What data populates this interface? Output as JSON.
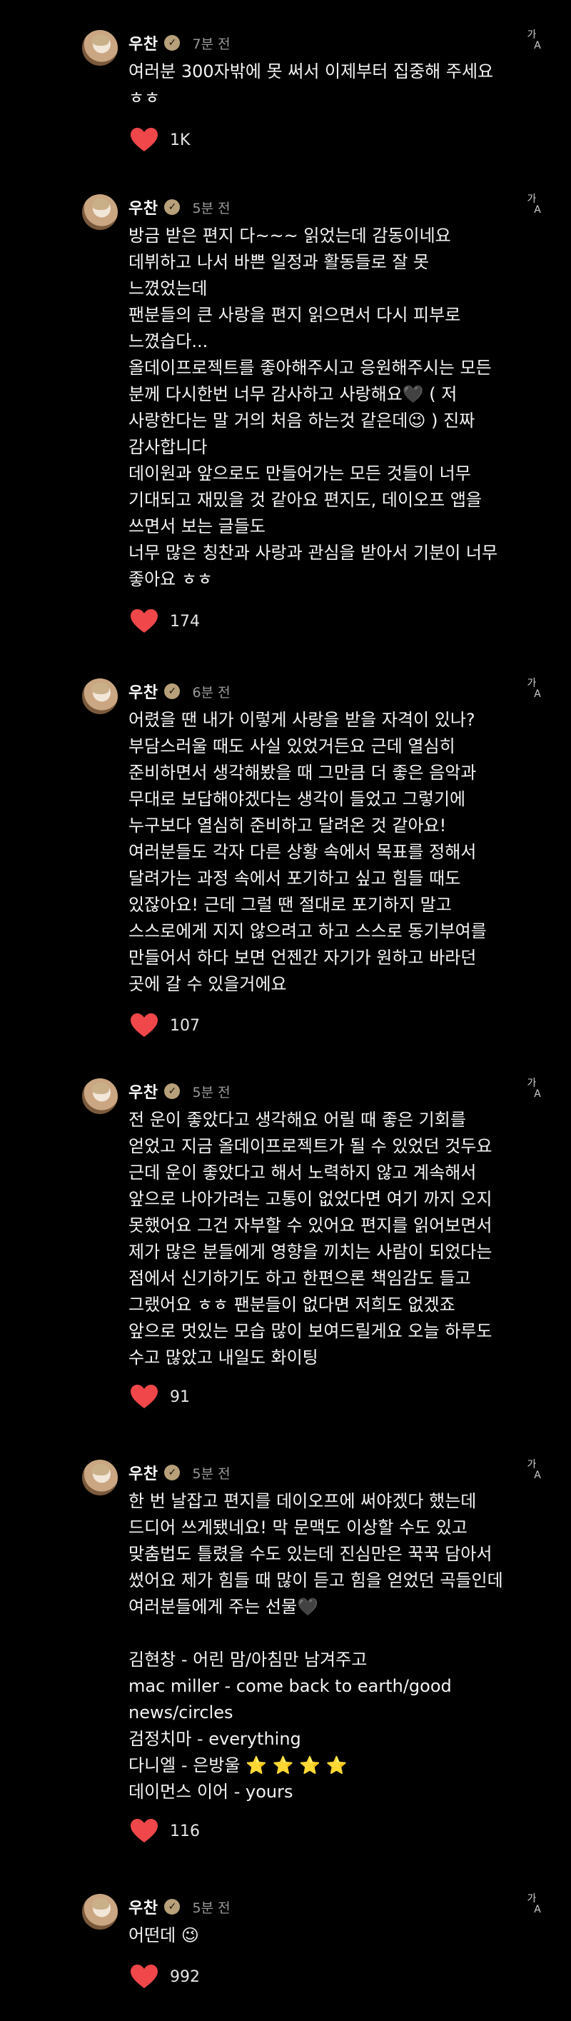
{
  "posts": [
    {
      "author": "우찬",
      "time": "7분 전",
      "text": "여러분 300자밖에 못 써서 이제부터 집중해 주세요 ㅎㅎ",
      "likes": "1K"
    },
    {
      "author": "우찬",
      "time": "5분 전",
      "text": "방금 받은 편지 다~~~ 읽었는데 감동이네요\n데뷔하고 나서 바쁜 일정과 활동들로 잘 못 느꼈었는데\n팬분들의 큰 사랑을 편지 읽으면서 다시 피부로 느꼈습다...\n올데이프로젝트를 좋아해주시고 응원해주시는 모든 분께 다시한번 너무 감사하고 사랑해요🖤 ( 저 사랑한다는 말 거의 처음 하는것 같은데😉 ) 진짜 감사합니다\n데이원과 앞으로도 만들어가는 모든 것들이 너무 기대되고 재밌을 것 같아요 편지도, 데이오프 앱을 쓰면서 보는 글들도\n너무 많은 칭찬과 사랑과 관심을 받아서 기분이 너무 좋아요 ㅎㅎ",
      "likes": "174"
    },
    {
      "author": "우찬",
      "time": "6분 전",
      "text": "어렸을 땐 내가 이렇게 사랑을 받을 자격이 있나? 부담스러울 때도 사실 있었거든요 근데 열심히 준비하면서 생각해봤을 때 그만큼 더 좋은 음악과 무대로 보답해야겠다는 생각이 들었고 그렇기에 누구보다 열심히 준비하고 달려온 것 같아요! 여러분들도 각자 다른 상황 속에서 목표를 정해서 달려가는 과정 속에서 포기하고 싶고 힘들 때도 있잖아요! 근데 그럴 땐 절대로 포기하지 말고 스스로에게 지지 않으려고 하고 스스로 동기부여를 만들어서 하다 보면 언젠간 자기가 원하고 바라던 곳에 갈 수 있을거에요",
      "likes": "107"
    },
    {
      "author": "우찬",
      "time": "5분 전",
      "text": "전 운이 좋았다고 생각해요 어릴 때 좋은 기회를 얻었고 지금 올데이프로젝트가 될 수 있었던 것두요 근데 운이 좋았다고 해서 노력하지 않고 계속해서 앞으로 나아가려는 고통이 없었다면 여기 까지 오지 못했어요 그건 자부할 수 있어요 편지를 읽어보면서 제가 많은 분들에게 영향을 끼치는 사람이 되었다는 점에서 신기하기도 하고 한편으론 책임감도 들고 그랬어요 ㅎㅎ 팬분들이 없다면 저희도 없겠죠 앞으로 멋있는 모습 많이 보여드릴게요 오늘 하루도 수고 많았고 내일도 화이팅",
      "likes": "91"
    },
    {
      "author": "우찬",
      "time": "5분 전",
      "text": "한 번 날잡고 편지를 데이오프에 써야겠다 했는데 드디어 쓰게됐네요! 막 문맥도 이상할 수도 있고 맞춤법도 틀렸을 수도 있는데 진심만은 꾹꾹 담아서 썼어요 제가 힘들 때 많이 듣고 힘을 얻었던 곡들인데 여러분들에게 주는 선물🖤\n\n김현창 - 어린 맘/아침만 남겨주고\nmac miller - come back to earth/good news/circles\n검정치마 - everything\n다니엘 - 은방울 ⭐ ⭐ ⭐ ⭐\n데이먼스 이어 - yours",
      "likes": "116"
    },
    {
      "author": "우찬",
      "time": "5분 전",
      "text": "어떤데 😉",
      "likes": "992"
    }
  ],
  "icons": {
    "translate": "translate-icon",
    "verified": "verified-badge-icon",
    "like": "heart-icon"
  },
  "colors": {
    "background": "#000000",
    "heart": "#f0474a",
    "badge": "#b7a07a"
  }
}
